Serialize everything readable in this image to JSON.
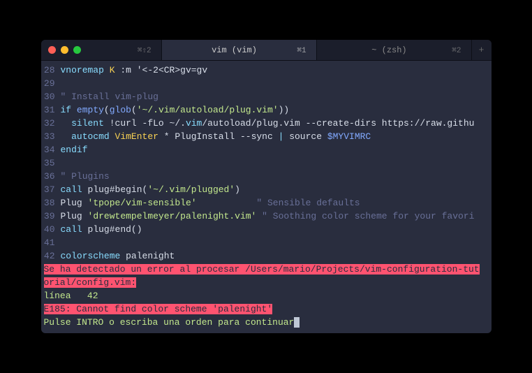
{
  "tabs": {
    "first_key": "⌘⇧2",
    "active_label": "vim (vim)",
    "active_key": "⌘1",
    "second_label": "~ (zsh)",
    "second_key": "⌘2"
  },
  "lines": {
    "l28": {
      "n": "28",
      "pre": "vnoremap",
      "k": " K",
      "rest": " :m '<-2<CR>gv=gv"
    },
    "l29": {
      "n": "29"
    },
    "l30": {
      "n": "30",
      "c": "\" Install vim-plug"
    },
    "l31": {
      "n": "31",
      "if": "if",
      "empty": " empty",
      "p1": "(",
      "glob": "glob",
      "p2": "(",
      "str": "'~/.vim/autoload/plug.vim'",
      "p3": "))"
    },
    "l32": {
      "n": "32",
      "silent": "  silent",
      "cmd": " !curl -fLo ~/.",
      "vim": "vim",
      "rest": "/autoload/plug.vim --create-dirs https://raw.githu"
    },
    "l33": {
      "n": "33",
      "autocmd": "  autocmd",
      "ve": " VimEnter",
      "star": " *",
      "pi": " PlugInstall --sync ",
      "pipe": "|",
      "src": " source ",
      "var": "$MYVIMRC"
    },
    "l34": {
      "n": "34",
      "endif": "endif"
    },
    "l35": {
      "n": "35"
    },
    "l36": {
      "n": "36",
      "c": "\" Plugins"
    },
    "l37": {
      "n": "37",
      "call": "call",
      "fn": " plug#begin(",
      "str": "'~/.vim/plugged'",
      "p": ")"
    },
    "l38": {
      "n": "38",
      "plug": "Plug",
      "str": " 'tpope/vim-sensible'",
      "pad": "           ",
      "c": "\" Sensible defaults"
    },
    "l39": {
      "n": "39",
      "plug": "Plug",
      "str": " 'drewtempelmeyer/palenight.vim'",
      "c": " \" Soothing color scheme for your favori"
    },
    "l40": {
      "n": "40",
      "call": "call",
      "fn": " plug#end()"
    },
    "l41": {
      "n": "41"
    },
    "l42": {
      "n": "42",
      "cs": "colorscheme",
      "name": " palenight"
    }
  },
  "errors": {
    "e1": "Se ha detectado un error al procesar /Users/mario/Projects/vim-configuration-tut",
    "e2": "orial/config.vim:",
    "e3": "línea   42",
    "e4": "E185: Cannot find color scheme 'palenight'",
    "e5": "Pulse INTRO o escriba una orden para continuar"
  }
}
